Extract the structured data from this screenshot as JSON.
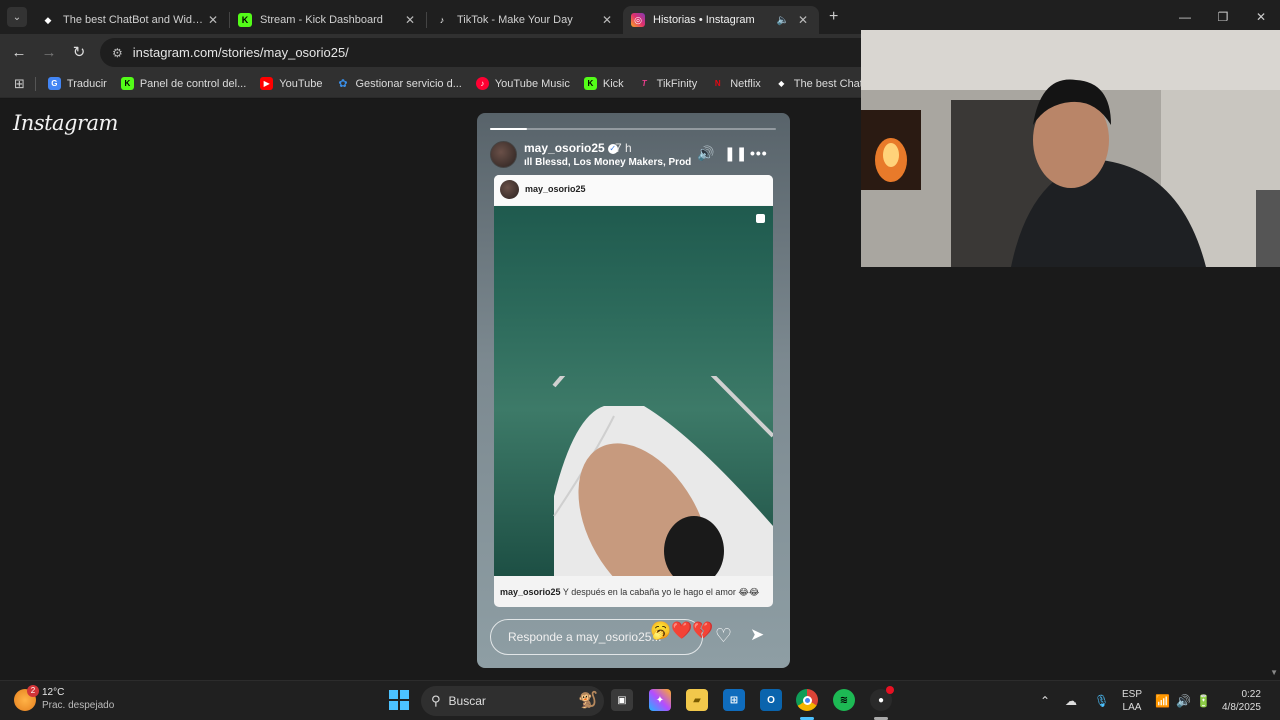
{
  "tabs": [
    {
      "title": "The best ChatBot and Widgets f",
      "favicon": "diamond-icon",
      "active": false
    },
    {
      "title": "Stream - Kick Dashboard",
      "favicon": "kick-icon",
      "active": false
    },
    {
      "title": "TikTok - Make Your Day",
      "favicon": "tiktok-icon",
      "active": false
    },
    {
      "title": "Historias • Instagram",
      "favicon": "instagram-icon",
      "active": true
    }
  ],
  "address_bar": {
    "url": "instagram.com/stories/may_osorio25/"
  },
  "bookmarks": [
    {
      "label": "Traducir",
      "color": "#4285f4",
      "glyph": "G"
    },
    {
      "label": "Panel de control del...",
      "color": "#53fc18",
      "glyph": "K"
    },
    {
      "label": "YouTube",
      "color": "#ff0000",
      "glyph": "▶"
    },
    {
      "label": "Gestionar servicio d...",
      "color": "#3a8ee6",
      "glyph": "✿"
    },
    {
      "label": "YouTube Music",
      "color": "#ff0033",
      "glyph": "♪"
    },
    {
      "label": "Kick",
      "color": "#53fc18",
      "glyph": "K"
    },
    {
      "label": "TikFinity",
      "color": "#e83e8c",
      "glyph": "T"
    },
    {
      "label": "Netflix",
      "color": "#e50914",
      "glyph": "N"
    },
    {
      "label": "The best ChatBot an...",
      "color": "#ffffff",
      "glyph": "◆"
    }
  ],
  "instagram": {
    "logo": "Instagram"
  },
  "story": {
    "username": "may_osorio25",
    "time": "7 h",
    "music": "Blessd, Los Money Makers, Prod",
    "progress": 0.13,
    "card_username": "may_osorio25",
    "caption_user": "may_osorio25",
    "caption_text": "Y después en la cabaña yo le hago el amor 😂😂",
    "reply_placeholder": "Responde a may_osorio25...",
    "reply_emojis": "🥱❤️💔"
  },
  "taskbar": {
    "weather_temp": "12°C",
    "weather_desc": "Prac. despejado",
    "weather_badge": "2",
    "search_label": "Buscar",
    "lang_top": "ESP",
    "lang_bottom": "LAA",
    "time": "0:22",
    "date": "4/8/2025"
  },
  "colors": {
    "accent": "#4cc2ff",
    "kick_green": "#53fc18",
    "instagram_pink": "#e1306c"
  }
}
